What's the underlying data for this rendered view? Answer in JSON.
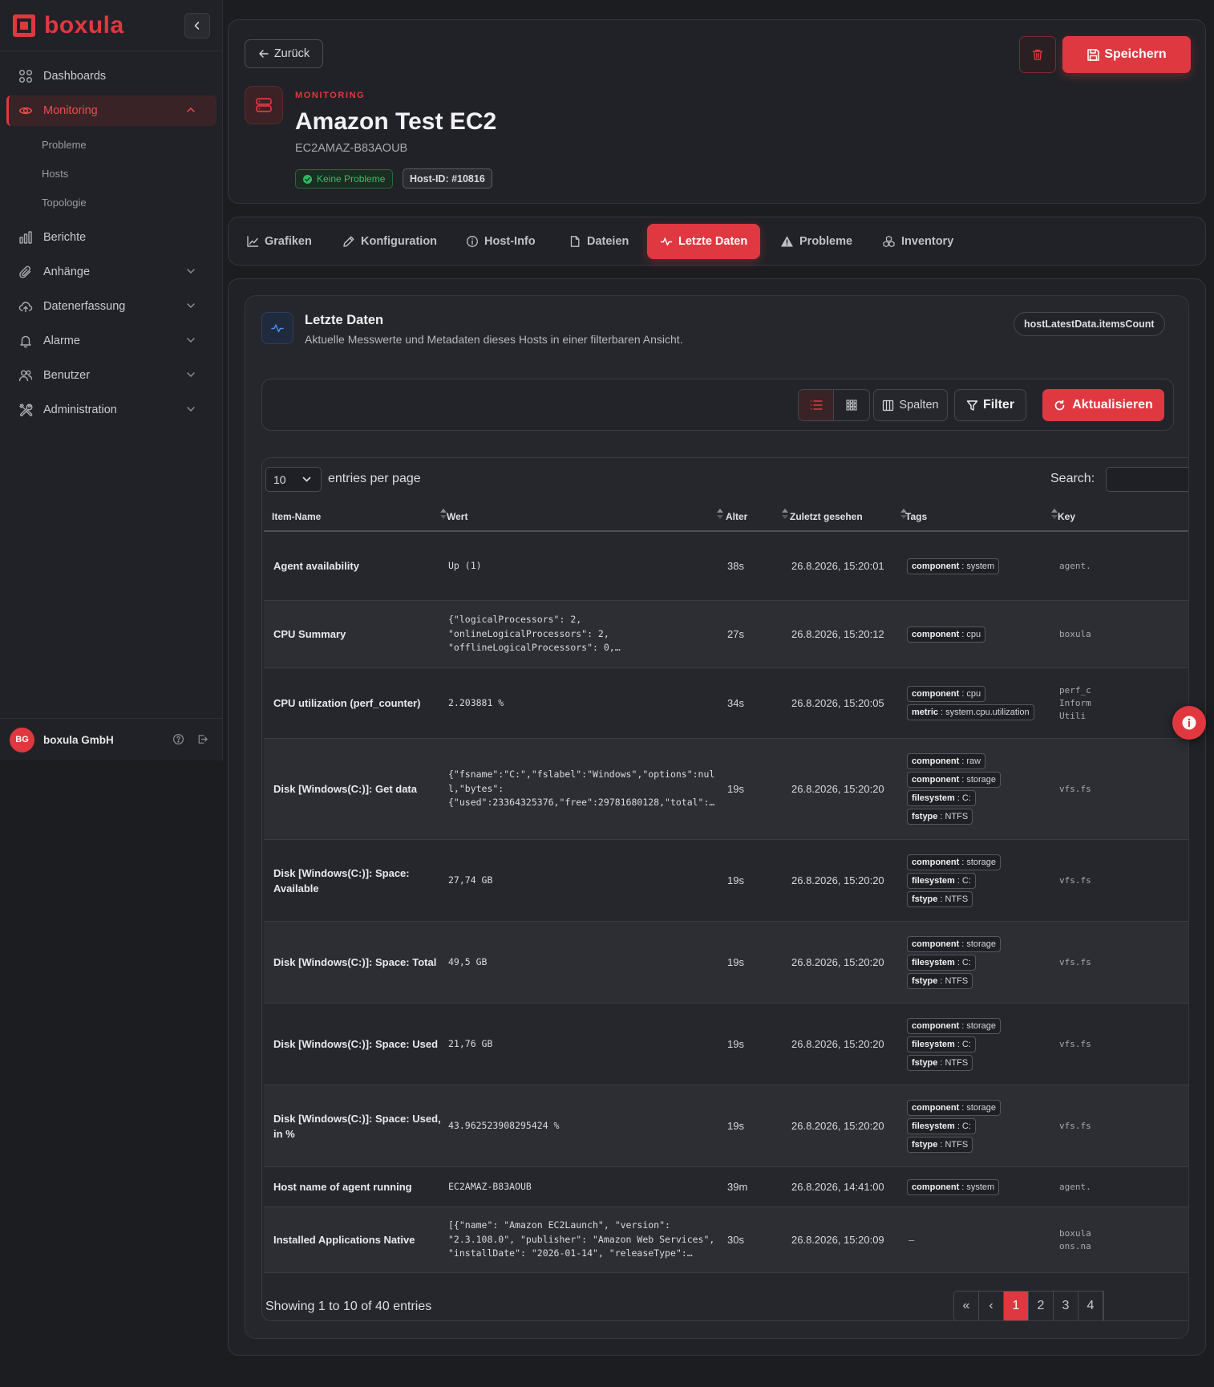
{
  "brand": {
    "name": "boxula",
    "color": "#e0383e"
  },
  "sidebar": {
    "items": [
      {
        "label": "Dashboards",
        "icon": "grid-icon"
      },
      {
        "label": "Monitoring",
        "icon": "eye-icon",
        "active": true
      },
      {
        "label": "Berichte",
        "icon": "bar-chart-icon"
      },
      {
        "label": "Anhänge",
        "icon": "paperclip-icon"
      },
      {
        "label": "Datenerfassung",
        "icon": "cloud-upload-icon"
      },
      {
        "label": "Alarme",
        "icon": "bell-icon"
      },
      {
        "label": "Benutzer",
        "icon": "users-icon"
      },
      {
        "label": "Administration",
        "icon": "tools-icon"
      }
    ],
    "monitoring_sub": [
      "Probleme",
      "Hosts",
      "Topologie"
    ],
    "user": {
      "initials": "BG",
      "name": "boxula GmbH"
    }
  },
  "header": {
    "back_label": "Zurück",
    "save_label": "Speichern",
    "eyebrow": "MONITORING",
    "title": "Amazon Test EC2",
    "subtitle": "EC2AMAZ-B83AOUB",
    "status_badge": "Keine Probleme",
    "host_id_badge": "Host-ID: #10816"
  },
  "tabs": [
    "Grafiken",
    "Konfiguration",
    "Host-Info",
    "Dateien",
    "Letzte Daten",
    "Probleme",
    "Inventory"
  ],
  "section": {
    "title": "Letzte Daten",
    "description": "Aktuelle Messwerte und Metadaten dieses Hosts in einer filterbaren Ansicht.",
    "count_pill": "hostLatestData.itemsCount"
  },
  "toolbar": {
    "columns_label": "Spalten",
    "filter_label": "Filter",
    "refresh_label": "Aktualisieren"
  },
  "table": {
    "length_value": "10",
    "length_label": "entries per page",
    "search_label": "Search:",
    "columns": [
      "Item-Name",
      "Wert",
      "Alter",
      "Zuletzt gesehen",
      "Tags",
      "Key"
    ],
    "rows": [
      {
        "name": "Agent availability",
        "value": "Up (1)",
        "age": "38s",
        "seen": "26.8.2026, 15:20:01",
        "tags": [
          [
            "component",
            "system"
          ]
        ],
        "key": "agent."
      },
      {
        "name": "CPU Summary",
        "value": "{\"logicalProcessors\": 2,\n\"onlineLogicalProcessors\": 2,\n\"offlineLogicalProcessors\": 0,…",
        "age": "27s",
        "seen": "26.8.2026, 15:20:12",
        "tags": [
          [
            "component",
            "cpu"
          ]
        ],
        "key": "boxula"
      },
      {
        "name": "CPU utilization (perf_counter)",
        "value": "2.203881 %",
        "age": "34s",
        "seen": "26.8.2026, 15:20:05",
        "tags": [
          [
            "component",
            "cpu"
          ],
          [
            "metric",
            "system.cpu.utilization"
          ]
        ],
        "key": "perf_c\nInform\nUtili"
      },
      {
        "name": "Disk [Windows(C:)]: Get data",
        "value": "{\"fsname\":\"C:\",\"fslabel\":\"Windows\",\"options\":nul\nl,\"bytes\":\n{\"used\":23364325376,\"free\":29781680128,\"total\":…",
        "age": "19s",
        "seen": "26.8.2026, 15:20:20",
        "tags": [
          [
            "component",
            "raw"
          ],
          [
            "component",
            "storage"
          ],
          [
            "filesystem",
            "C:"
          ],
          [
            "fstype",
            "NTFS"
          ]
        ],
        "key": "vfs.fs"
      },
      {
        "name": "Disk [Windows(C:)]: Space: Available",
        "value": "27,74 GB",
        "age": "19s",
        "seen": "26.8.2026, 15:20:20",
        "tags": [
          [
            "component",
            "storage"
          ],
          [
            "filesystem",
            "C:"
          ],
          [
            "fstype",
            "NTFS"
          ]
        ],
        "key": "vfs.fs"
      },
      {
        "name": "Disk [Windows(C:)]: Space: Total",
        "value": "49,5 GB",
        "age": "19s",
        "seen": "26.8.2026, 15:20:20",
        "tags": [
          [
            "component",
            "storage"
          ],
          [
            "filesystem",
            "C:"
          ],
          [
            "fstype",
            "NTFS"
          ]
        ],
        "key": "vfs.fs"
      },
      {
        "name": "Disk [Windows(C:)]: Space: Used",
        "value": "21,76 GB",
        "age": "19s",
        "seen": "26.8.2026, 15:20:20",
        "tags": [
          [
            "component",
            "storage"
          ],
          [
            "filesystem",
            "C:"
          ],
          [
            "fstype",
            "NTFS"
          ]
        ],
        "key": "vfs.fs"
      },
      {
        "name": "Disk [Windows(C:)]: Space: Used, in %",
        "value": "43.962523908295424 %",
        "age": "19s",
        "seen": "26.8.2026, 15:20:20",
        "tags": [
          [
            "component",
            "storage"
          ],
          [
            "filesystem",
            "C:"
          ],
          [
            "fstype",
            "NTFS"
          ]
        ],
        "key": "vfs.fs"
      },
      {
        "name": "Host name of agent running",
        "value": "EC2AMAZ-B83AOUB",
        "age": "39m",
        "seen": "26.8.2026, 14:41:00",
        "tags": [
          [
            "component",
            "system"
          ]
        ],
        "key": "agent."
      },
      {
        "name": "Installed Applications Native",
        "value": "[{\"name\": \"Amazon EC2Launch\", \"version\":\n\"2.3.108.0\", \"publisher\": \"Amazon Web Services\",\n\"installDate\": \"2026-01-14\", \"releaseType\":…",
        "age": "30s",
        "seen": "26.8.2026, 15:20:09",
        "tags": [],
        "empty_tags": "–",
        "key": "boxula\nons.na"
      }
    ],
    "info": "Showing 1 to 10 of 40 entries",
    "pages": [
      "«",
      "‹",
      "1",
      "2",
      "3",
      "4"
    ],
    "current_page": "1"
  }
}
